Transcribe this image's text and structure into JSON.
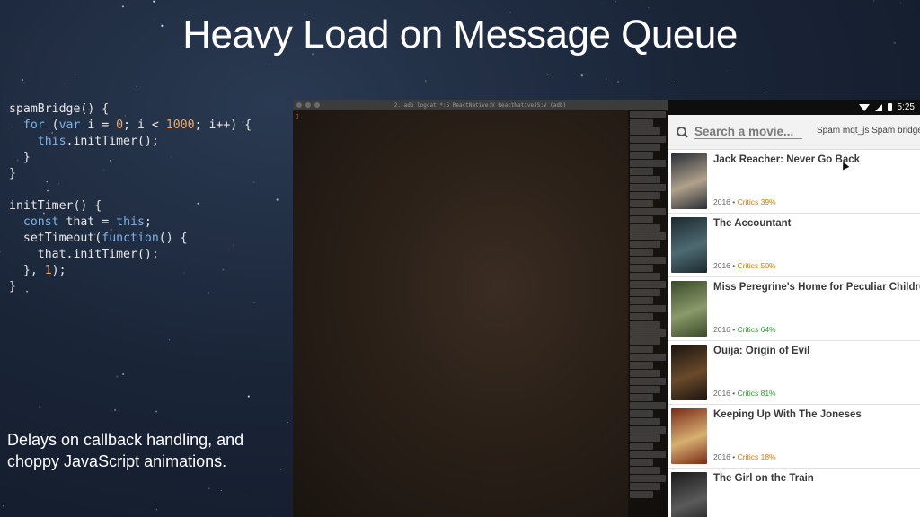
{
  "slide": {
    "title": "Heavy Load on Message Queue",
    "caption": "Delays on callback handling, and choppy JavaScript animations."
  },
  "code": {
    "lines": [
      "spamBridge() {",
      "  for (var i = 0; i < 1000; i++) {",
      "    this.initTimer();",
      "  }",
      "}",
      "",
      "initTimer() {",
      "  const that = this;",
      "  setTimeout(function() {",
      "    that.initTimer();",
      "  }, 1);",
      "}"
    ]
  },
  "terminal": {
    "title": "2. adb logcat *:S ReactNative:V ReactNativeJS:V (adb)",
    "cursor": "▯"
  },
  "phone": {
    "status_time": "5:25",
    "search_placeholder": "Search a movie...",
    "spam_label": "Spam mqt_js Spam bridge",
    "movies": [
      {
        "title": "Jack Reacher: Never Go Back",
        "year": "2016",
        "critics": "Critics 39%",
        "critics_color": "#e07b00",
        "poster_colors": [
          "#2a2f38",
          "#b0a18a"
        ]
      },
      {
        "title": "The Accountant",
        "year": "2016",
        "critics": "Critics 50%",
        "critics_color": "#e07b00",
        "poster_colors": [
          "#1d2a2e",
          "#4d6a72"
        ]
      },
      {
        "title": "Miss Peregrine's Home for Peculiar Children",
        "year": "2016",
        "critics": "Critics 64%",
        "critics_color": "#2e9a2e",
        "poster_colors": [
          "#3a4a2a",
          "#8a9a6a"
        ]
      },
      {
        "title": "Ouija: Origin of Evil",
        "year": "2016",
        "critics": "Critics 81%",
        "critics_color": "#2e9a2e",
        "poster_colors": [
          "#1a1410",
          "#6a4a2a"
        ]
      },
      {
        "title": "Keeping Up With The Joneses",
        "year": "2016",
        "critics": "Critics 18%",
        "critics_color": "#e07b00",
        "poster_colors": [
          "#7a2a1a",
          "#d8b070"
        ]
      },
      {
        "title": "The Girl on the Train",
        "year": "",
        "critics": "",
        "critics_color": "#2e9a2e",
        "poster_colors": [
          "#1a1a1a",
          "#5a5a5a"
        ]
      }
    ]
  },
  "colors": {
    "background": "#1a2538",
    "keyword": "#7fb3e6",
    "number": "#f0a868",
    "critics_rotten": "#e07b00",
    "critics_fresh": "#2e9a2e"
  }
}
